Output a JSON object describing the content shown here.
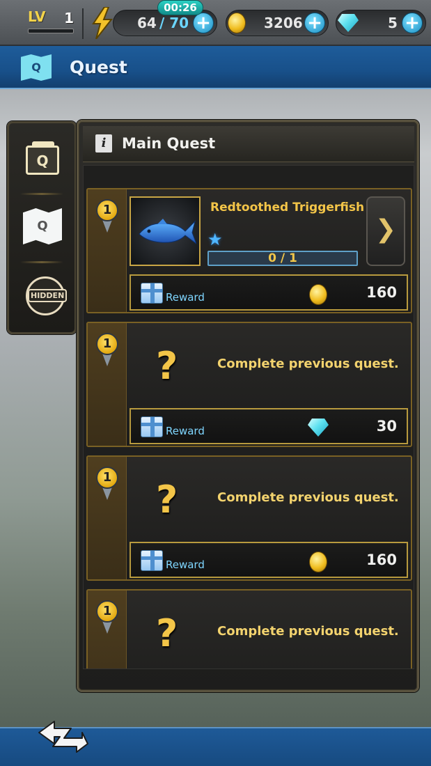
{
  "topbar": {
    "level_label": "LV",
    "level_value": "1",
    "level_progress": 0.0,
    "energy_current": "64",
    "energy_max": "/ 70",
    "energy_timer": "00:26",
    "gold": "3206",
    "gems": "5"
  },
  "header": {
    "icon_letter": "Q",
    "title": "Quest"
  },
  "tabs": [
    {
      "name": "calendar",
      "letter": "Q",
      "active": false
    },
    {
      "name": "map",
      "letter": "Q",
      "active": true
    },
    {
      "name": "hidden",
      "text": "HIDDEN",
      "active": false
    }
  ],
  "panel": {
    "title": "Main Quest",
    "info_glyph": "i"
  },
  "quests": [
    {
      "index": "1",
      "name": "Redtoothed Triggerfish",
      "stars": "★",
      "progress_text": "0 / 1",
      "progress": 0.0,
      "go_glyph": "❯",
      "reward_label": "Reward",
      "reward_type": "coin",
      "reward_value": "160"
    },
    {
      "index": "1",
      "qmark": "?",
      "locked_text": "Complete previous quest.",
      "reward_label": "Reward",
      "reward_type": "gem",
      "reward_value": "30"
    },
    {
      "index": "1",
      "qmark": "?",
      "locked_text": "Complete previous quest.",
      "reward_label": "Reward",
      "reward_type": "coin",
      "reward_value": "160"
    },
    {
      "index": "1",
      "qmark": "?",
      "locked_text": "Complete previous quest."
    }
  ],
  "colors": {
    "accent_gold": "#f3c548",
    "header_blue": "#1e5c9a",
    "reward_blue": "#7fd6ff"
  }
}
